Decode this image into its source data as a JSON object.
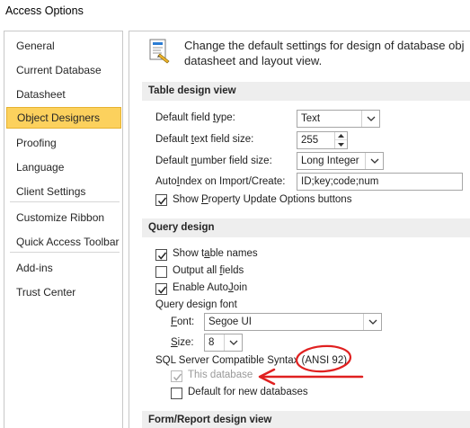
{
  "window": {
    "title": "Access Options"
  },
  "sidebar": {
    "items": [
      {
        "label": "General"
      },
      {
        "label": "Current Database"
      },
      {
        "label": "Datasheet"
      },
      {
        "label": "Object Designers"
      },
      {
        "label": "Proofing"
      },
      {
        "label": "Language"
      },
      {
        "label": "Client Settings"
      },
      {
        "label": "Customize Ribbon"
      },
      {
        "label": "Quick Access Toolbar"
      },
      {
        "label": "Add-ins"
      },
      {
        "label": "Trust Center"
      }
    ],
    "selected": "Object Designers"
  },
  "header": {
    "line1": "Change the default settings for design of database obj",
    "line2": "datasheet and layout view."
  },
  "table_design": {
    "title": "Table design view",
    "field_type": {
      "pre": "Default field ",
      "u": "t",
      "post": "ype:",
      "value": "Text"
    },
    "text_size": {
      "pre": "Default ",
      "u": "t",
      "post": "ext field size:",
      "value": "255"
    },
    "number_size": {
      "pre": "Default ",
      "u": "n",
      "post": "umber field size:",
      "value": "Long Integer"
    },
    "autoindex": {
      "pre": "Auto",
      "u": "I",
      "post": "ndex on Import/Create:",
      "value": "ID;key;code;num"
    },
    "show_property": {
      "pre": "Show ",
      "u": "P",
      "post": "roperty Update Options buttons",
      "checked": true
    }
  },
  "query_design": {
    "title": "Query design",
    "show_table_names": {
      "pre": "Show t",
      "u": "a",
      "post": "ble names",
      "checked": true
    },
    "output_all_fields": {
      "pre": "Output all ",
      "u": "f",
      "post": "ields",
      "checked": false
    },
    "enable_autojoin": {
      "pre": "Enable Auto",
      "u": "J",
      "post": "oin",
      "checked": true
    },
    "font_group_label": "Query design font",
    "font": {
      "u": "F",
      "post": "ont:",
      "value": "Segoe UI"
    },
    "size": {
      "u": "S",
      "post": "ize:",
      "value": "8"
    },
    "sql_compat": {
      "label": "SQL Server Compatible Syntax (ANSI 92)"
    },
    "this_database": {
      "label": "This database",
      "checked": true,
      "disabled": true
    },
    "default_new": {
      "label": "Default for new databases",
      "checked": false
    }
  },
  "form_report": {
    "title": "Form/Report design view"
  },
  "annotation": {
    "color": "#e02020"
  }
}
